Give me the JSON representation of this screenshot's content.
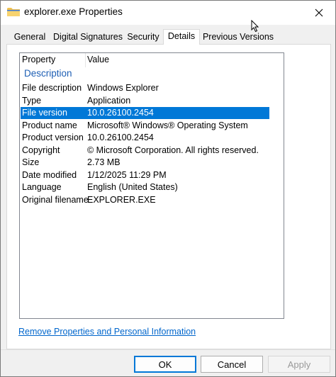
{
  "window": {
    "title": "explorer.exe Properties"
  },
  "tabs": [
    {
      "label": "General"
    },
    {
      "label": "Digital Signatures"
    },
    {
      "label": "Security"
    },
    {
      "label": "Details"
    },
    {
      "label": "Previous Versions"
    }
  ],
  "active_tab": "Details",
  "details": {
    "header": {
      "property": "Property",
      "value": "Value"
    },
    "group": "Description",
    "rows": [
      {
        "property": "File description",
        "value": "Windows Explorer"
      },
      {
        "property": "Type",
        "value": "Application"
      },
      {
        "property": "File version",
        "value": "10.0.26100.2454"
      },
      {
        "property": "Product name",
        "value": "Microsoft® Windows® Operating System"
      },
      {
        "property": "Product version",
        "value": "10.0.26100.2454"
      },
      {
        "property": "Copyright",
        "value": "© Microsoft Corporation. All rights reserved."
      },
      {
        "property": "Size",
        "value": "2.73 MB"
      },
      {
        "property": "Date modified",
        "value": "1/12/2025 11:29 PM"
      },
      {
        "property": "Language",
        "value": "English (United States)"
      },
      {
        "property": "Original filename",
        "value": "EXPLORER.EXE"
      }
    ],
    "selected_row": "File version"
  },
  "remove_link": "Remove Properties and Personal Information",
  "buttons": {
    "ok": "OK",
    "cancel": "Cancel",
    "apply": "Apply"
  },
  "colors": {
    "selection": "#0078d7",
    "link": "#0066cc",
    "group_header": "#1e5fb4"
  },
  "icons": {
    "title": "folder-icon",
    "close": "close-icon"
  }
}
